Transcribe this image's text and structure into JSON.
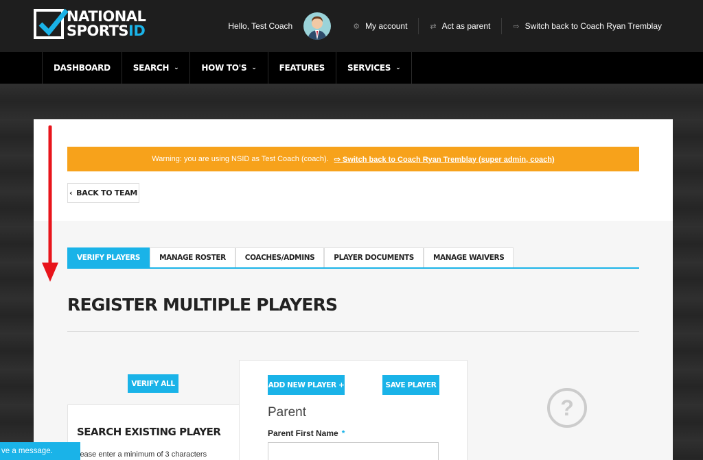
{
  "brand": {
    "line1": "NATIONAL",
    "line2a": "SPORTS",
    "line2b": "ID"
  },
  "top": {
    "hello": "Hello, Test Coach",
    "my_account": "My account",
    "act_as_parent": "Act as parent",
    "switch_back": "Switch back to Coach Ryan Tremblay"
  },
  "nav": [
    {
      "label": "DASHBOARD"
    },
    {
      "label": "SEARCH"
    },
    {
      "label": "HOW TO'S"
    },
    {
      "label": "FEATURES"
    },
    {
      "label": "SERVICES"
    }
  ],
  "warning": {
    "text": "Warning: you are using NSID as Test Coach (coach).",
    "link": "Switch back to Coach Ryan Tremblay (super admin, coach)"
  },
  "back_button": "BACK TO TEAM",
  "tabs": [
    {
      "label": "VERIFY PLAYERS"
    },
    {
      "label": "MANAGE ROSTER"
    },
    {
      "label": "COACHES/ADMINS"
    },
    {
      "label": "PLAYER DOCUMENTS"
    },
    {
      "label": "MANAGE WAIVERS"
    }
  ],
  "page_title": "REGISTER MULTIPLE PLAYERS",
  "verify_all": "VERIFY ALL",
  "search": {
    "title": "SEARCH EXISTING PLAYER",
    "hint": "lease enter a minimum of 3 characters"
  },
  "form": {
    "add_player": "ADD NEW PLAYER",
    "add_symbol": "+",
    "save_player": "SAVE PLAYER",
    "parent_heading": "Parent",
    "parent_first_name_label": "Parent First Name",
    "required_mark": "*",
    "parent_first_name_value": ""
  },
  "help_symbol": "?",
  "chat": "ve a message.",
  "colors": {
    "accent": "#1ab3e8",
    "warning": "#f7a21b",
    "arrow": "#e8141b"
  },
  "icons": [
    "gear-icon",
    "swap-icon",
    "switch-icon",
    "chevron-down-icon",
    "chevron-left-icon",
    "help-icon"
  ]
}
